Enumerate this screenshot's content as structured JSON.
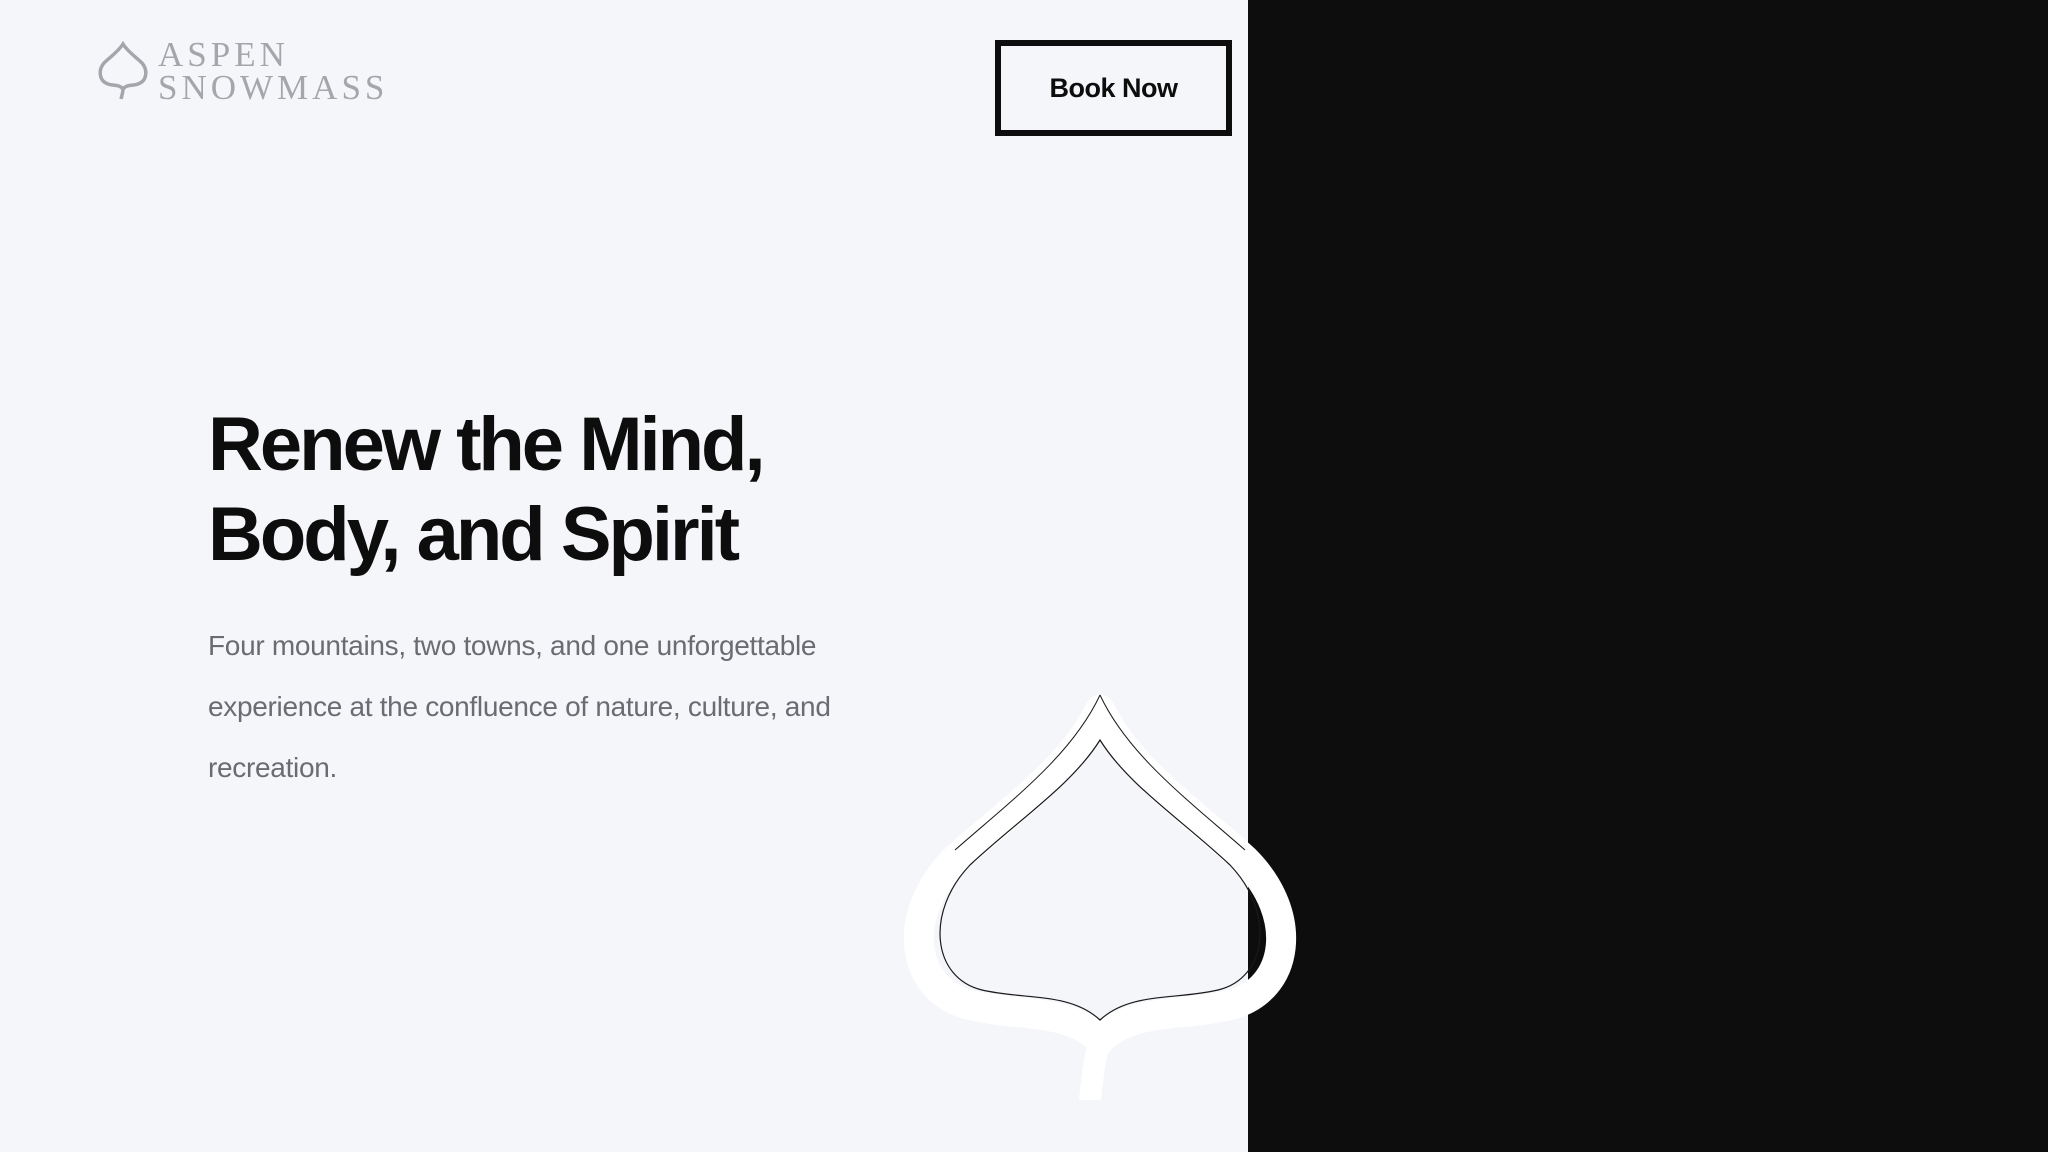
{
  "header": {
    "logo": {
      "line1": "ASPEN",
      "line2": "SNOWMASS",
      "icon": "aspen-leaf-icon"
    },
    "book_button_label": "Book Now"
  },
  "hero": {
    "title_line1": "Renew the Mind,",
    "title_line2": "Body, and Spirit",
    "subtitle": "Four mountains, two towns, and one unforgettable experience at the confluence of nature, culture, and recreation.",
    "decoration_icon": "aspen-leaf-icon"
  },
  "colors": {
    "background": "#f5f6fa",
    "dark_panel": "#0d0d0d",
    "text_primary": "#0d0d0d",
    "text_secondary": "#6a6c72",
    "logo": "#a4a6ab"
  }
}
